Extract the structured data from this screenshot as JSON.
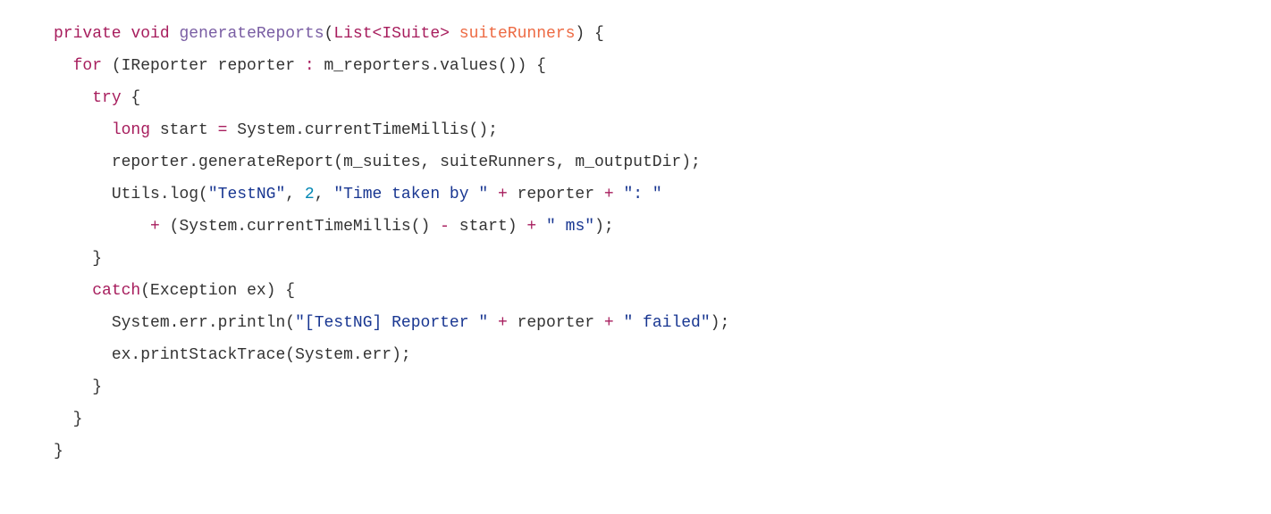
{
  "code": {
    "line1": {
      "kw_private": "private",
      "kw_void": "void",
      "method_name": "generateReports",
      "paren_open": "(",
      "type_list": "List",
      "angle_open": "<",
      "type_isuite": "ISuite",
      "angle_close": ">",
      "param_name": "suiteRunners",
      "paren_close": ")",
      "brace_open": " {"
    },
    "line2": {
      "indent": "  ",
      "kw_for": "for",
      "paren_open": " (",
      "type_ireporter": "IReporter",
      "var_reporter": " reporter ",
      "colon": ":",
      "expr": " m_reporters",
      "dot": ".",
      "method_values": "values",
      "parens": "()",
      "paren_close": ")",
      "brace_open": " {"
    },
    "line3": {
      "indent": "    ",
      "kw_try": "try",
      "brace_open": " {"
    },
    "line4": {
      "indent": "      ",
      "kw_long": "long",
      "var_start": " start ",
      "assign": "=",
      "sys": " System",
      "dot": ".",
      "method": "currentTimeMillis",
      "parens": "();"
    },
    "line5": {
      "indent": "      ",
      "reporter": "reporter",
      "dot1": ".",
      "method": "generateReport",
      "paren_open": "(",
      "arg1": "m_suites",
      "comma1": ", ",
      "arg2": "suiteRunners",
      "comma2": ", ",
      "arg3": "m_outputDir",
      "paren_close": ");"
    },
    "line6": {
      "indent": "      ",
      "utils": "Utils",
      "dot": ".",
      "log": "log",
      "paren_open": "(",
      "str1": "\"TestNG\"",
      "comma1": ", ",
      "num": "2",
      "comma2": ", ",
      "str2": "\"Time taken by \"",
      "space1": " ",
      "plus1": "+",
      "space2": " ",
      "reporter": "reporter",
      "space3": " ",
      "plus2": "+",
      "space4": " ",
      "str3": "\": \""
    },
    "line7": {
      "indent": "          ",
      "plus1": "+",
      "space1": " ",
      "paren_open": "(",
      "sys": "System",
      "dot": ".",
      "method": "currentTimeMillis",
      "parens": "()",
      "space2": " ",
      "minus": "-",
      "space3": " ",
      "start": "start",
      "paren_close": ")",
      "space4": " ",
      "plus2": "+",
      "space5": " ",
      "str": "\" ms\"",
      "end": ");"
    },
    "line8": {
      "indent": "    ",
      "brace_close": "}"
    },
    "line9": {
      "indent": "    ",
      "kw_catch": "catch",
      "paren_open": "(",
      "type_exception": "Exception",
      "var_ex": " ex",
      "paren_close": ")",
      "brace_open": " {"
    },
    "line10": {
      "indent": "      ",
      "sys": "System",
      "dot1": ".",
      "err": "err",
      "dot2": ".",
      "println": "println",
      "paren_open": "(",
      "str1": "\"[TestNG] Reporter \"",
      "space1": " ",
      "plus1": "+",
      "space2": " ",
      "reporter": "reporter",
      "space3": " ",
      "plus2": "+",
      "space4": " ",
      "str2": "\" failed\"",
      "paren_close": ");"
    },
    "line11": {
      "indent": "      ",
      "ex": "ex",
      "dot": ".",
      "method": "printStackTrace",
      "paren_open": "(",
      "sys": "System",
      "dot2": ".",
      "err": "err",
      "paren_close": ");"
    },
    "line12": {
      "indent": "    ",
      "brace_close": "}"
    },
    "line13": {
      "indent": "  ",
      "brace_close": "}"
    },
    "line14": {
      "indent": "",
      "brace_close": "}"
    }
  }
}
